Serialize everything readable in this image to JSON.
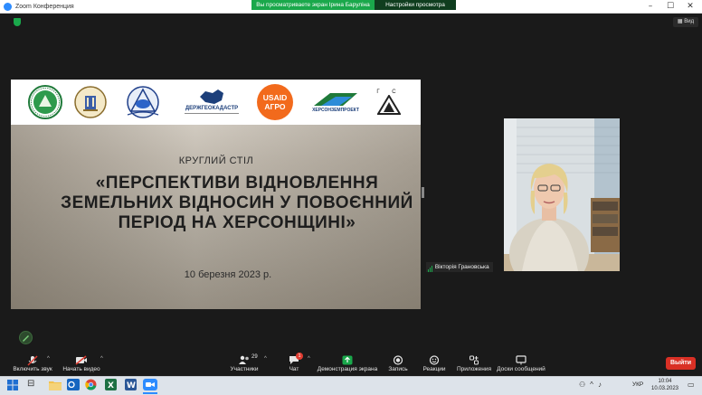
{
  "window": {
    "title": "Zoom Конференция",
    "controls": [
      "–",
      "☐",
      "✕"
    ]
  },
  "share_bar": {
    "banner": "Вы просматриваете экран Ірина Баруліна",
    "settings": "Настройки просмотра"
  },
  "meeting": {
    "view_label": "Вид"
  },
  "slide": {
    "logos": [
      "round-green-logo",
      "university-logo",
      "agrarian-university-logo",
      "dergeokadastr-logo",
      "usaid-agro-logo",
      "khersonzemproekt-logo",
      "gis-logo"
    ],
    "logo_texts": {
      "dergeokadastr": "ДЕРЖГЕОКАДАСТР",
      "usaid_line1": "USAID",
      "usaid_line2": "АГРО",
      "khersonzemproekt": "ХЕРСОНЗЕМПРОЕКТ",
      "gis": "Г С"
    },
    "subtitle": "КРУГЛИЙ СТІЛ",
    "title": "«ПЕРСПЕКТИВИ ВІДНОВЛЕННЯ ЗЕМЕЛЬНИХ ВІДНОСИН У ПОВОЄННИЙ ПЕРІОД НА ХЕРСОНЩИНІ»",
    "date": "10 березня 2023 р."
  },
  "participant": {
    "name": "Вікторія Грановська"
  },
  "toolbar": {
    "mute_label": "Включить звук",
    "video_label": "Начать видео",
    "participants_label": "Участники",
    "participants_count": "29",
    "chat_label": "Чат",
    "chat_badge": "1",
    "share_label": "Демонстрация экрана",
    "record_label": "Запись",
    "reactions_label": "Реакции",
    "apps_label": "Приложения",
    "whiteboard_label": "Доски сообщений",
    "leave_label": "Выйти"
  },
  "taskbar": {
    "lang": "УКР",
    "time": "10:04",
    "date": "10.03.2023",
    "apps": [
      "windows-start",
      "search",
      "task-view",
      "file-explorer",
      "word",
      "excel",
      "chrome",
      "word-2",
      "zoom"
    ]
  },
  "colors": {
    "zoom_blue": "#2d8cff",
    "share_green": "#1aa84b",
    "leave_red": "#d93025",
    "meeting_bg": "#1a1a1a"
  }
}
